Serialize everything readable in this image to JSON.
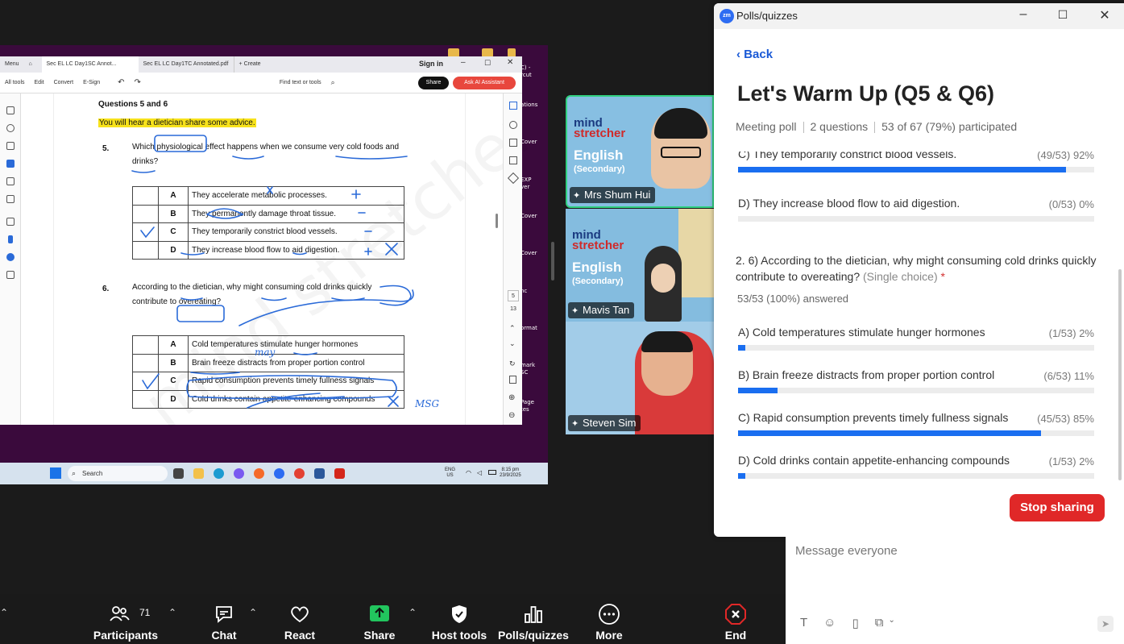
{
  "acrobat": {
    "tabs": [
      "Menu",
      "Sec EL LC Day1SC Annot...",
      "Sec EL LC Day1TC Annotated.pdf",
      "Create"
    ],
    "sign_in": "Sign in",
    "tools": [
      "All tools",
      "Edit",
      "Convert",
      "E-Sign"
    ],
    "find": "Find text or tools",
    "share": "Share",
    "ai": "Ask AI Assistant",
    "page_num": "5",
    "page_total": "13"
  },
  "document": {
    "heading": "Questions 5 and 6",
    "intro": "You will hear a dietician share some advice.",
    "q5": {
      "number": "5.",
      "line1": "Which physiological effect happens when we consume very cold foods and",
      "line2": "drinks?",
      "options": [
        {
          "letter": "A",
          "text": "They accelerate metabolic processes."
        },
        {
          "letter": "B",
          "text": "They permanently damage throat tissue."
        },
        {
          "letter": "C",
          "text": "They temporarily constrict blood vessels."
        },
        {
          "letter": "D",
          "text": "They increase blood flow to aid digestion."
        }
      ]
    },
    "q6": {
      "number": "6.",
      "line1": "According to the dietician, why might consuming cold drinks quickly",
      "line2": "contribute to overeating?",
      "options": [
        {
          "letter": "A",
          "text": "Cold temperatures stimulate hunger hormones"
        },
        {
          "letter": "B",
          "text": "Brain freeze distracts from proper portion control"
        },
        {
          "letter": "C",
          "text": "Rapid consumption prevents timely fullness signals"
        },
        {
          "letter": "D",
          "text": "Cold drinks contain appetite-enhancing compounds"
        }
      ]
    },
    "ink_msg": "MSG",
    "ink_may": "may",
    "watermark": "mind stretcher"
  },
  "taskbar": {
    "search": "Search",
    "lang1": "ENG",
    "lang2": "US",
    "time": "8:15 pm",
    "date": "23/9/2025"
  },
  "desktop": {
    "labels": [
      "C) -",
      "rcut",
      "ations",
      "Cover",
      "EXP",
      "ver",
      "Cover",
      "Cover",
      "nc",
      "ormat",
      "mark",
      "SC",
      "Page",
      "tes"
    ]
  },
  "videos": [
    {
      "name": "Mrs Shum Hui",
      "brand1": "mind",
      "brand2": "stretcher",
      "brand3": "English",
      "brand4": "(Secondary)"
    },
    {
      "name": "Mavis Tan",
      "brand1": "mind",
      "brand2": "stretcher",
      "brand3": "English",
      "brand4": "(Secondary)"
    },
    {
      "name": "Steven Sim"
    }
  ],
  "poll": {
    "window_title": "Polls/quizzes",
    "back": "Back",
    "title": "Let's Warm Up (Q5 & Q6)",
    "meta_type": "Meeting poll",
    "meta_questions": "2 questions",
    "meta_participation": "53 of 67 (79%) participated",
    "q1_options": [
      {
        "label": "C) They temporarily constrict blood vessels.",
        "count": "(49/53) 92%",
        "fraction": 0.92
      },
      {
        "label": "D) They increase blood flow to aid digestion.",
        "count": "(0/53) 0%",
        "fraction": 0.0
      }
    ],
    "q2_text": "2. 6) According to the dietician, why might consuming cold drinks quickly contribute to overeating?",
    "q2_hint": "(Single choice)",
    "q2_required": "*",
    "q2_answered": "53/53 (100%) answered",
    "q2_options": [
      {
        "label": "A) Cold temperatures stimulate hunger hormones",
        "count": "(1/53) 2%",
        "fraction": 0.02
      },
      {
        "label": "B) Brain freeze distracts from proper portion control",
        "count": "(6/53) 11%",
        "fraction": 0.11
      },
      {
        "label": "C) Rapid consumption prevents timely fullness signals",
        "count": "(45/53) 85%",
        "fraction": 0.85
      },
      {
        "label": "D) Cold drinks contain appetite-enhancing compounds",
        "count": "(1/53) 2%",
        "fraction": 0.02
      }
    ],
    "stop_sharing": "Stop sharing",
    "accent": "#1a6ef0",
    "stop_color": "#e02828"
  },
  "chat": {
    "placeholder": "Message everyone"
  },
  "toolbar": {
    "participants_label": "Participants",
    "participants_count": "71",
    "chat_label": "Chat",
    "react_label": "React",
    "share_label": "Share",
    "host_tools_label": "Host tools",
    "polls_label": "Polls/quizzes",
    "more_label": "More",
    "end_label": "End"
  }
}
